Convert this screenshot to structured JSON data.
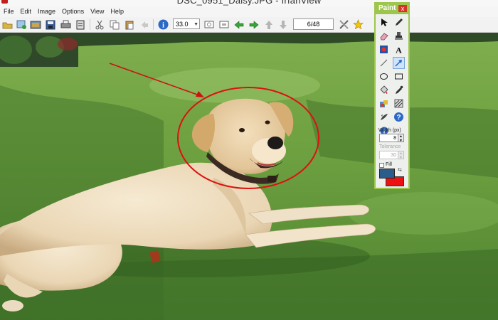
{
  "window": {
    "title": "DSC_0951_Daisy.JPG - IrfanView"
  },
  "menu": [
    "File",
    "Edit",
    "Image",
    "Options",
    "View",
    "Help"
  ],
  "toolbar": {
    "zoom_value": "33.0",
    "page_counter": "6/48",
    "icons": [
      "open-folder-icon",
      "slideshow-icon",
      "thumbnails-icon",
      "save-icon",
      "print-icon",
      "scanner-icon",
      "cut-icon",
      "copy-icon",
      "paste-icon",
      "undo-icon",
      "info-icon",
      "fit-window-icon",
      "original-size-icon",
      "prev-icon",
      "next-icon",
      "prev-dir-icon",
      "next-dir-icon",
      "settings-icon",
      "favorite-icon"
    ]
  },
  "paint_dialog": {
    "title": "Paint",
    "close_label": "x",
    "width_label": "Width (px)",
    "width_value": "8",
    "tolerance_label": "Tolerance",
    "tolerance_value": "30",
    "fill_label": "Fill",
    "selected_tool": "line-arrow",
    "foreground_color": "#2b5d8c",
    "background_color": "#ee1111"
  },
  "annotations": {
    "ellipse_color": "#dd1111",
    "arrow_color": "#cc1111"
  }
}
